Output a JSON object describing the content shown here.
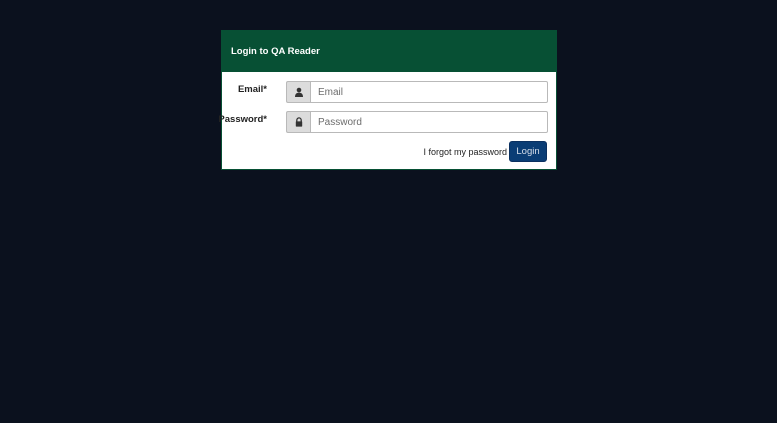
{
  "login_panel": {
    "title": "Login to QA Reader",
    "email": {
      "label": "Email*",
      "placeholder": "Email",
      "value": "",
      "icon": "user-icon"
    },
    "password": {
      "label": "Password*",
      "placeholder": "Password",
      "value": "",
      "icon": "lock-icon"
    },
    "forgot_password_label": "I forgot my password",
    "login_button_label": "Login"
  },
  "colors": {
    "page_background": "#0b111e",
    "header_background": "#075034",
    "button_background": "#0a3d75"
  }
}
